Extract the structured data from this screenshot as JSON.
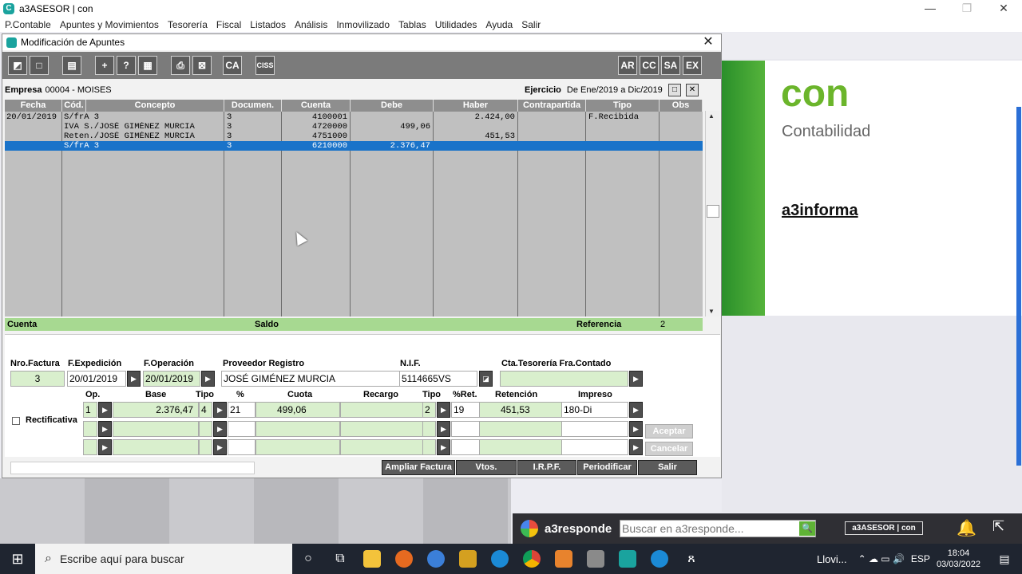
{
  "app": {
    "title": "a3ASESOR | con"
  },
  "menu": [
    "P.Contable",
    "Apuntes y Movimientos",
    "Tesorería",
    "Fiscal",
    "Listados",
    "Análisis",
    "Inmovilizado",
    "Tablas",
    "Utilidades",
    "Ayuda",
    "Salir"
  ],
  "dialog": {
    "title": "Modificación de Apuntes",
    "toolbar_right": [
      "AR",
      "CC",
      "SA",
      "EX"
    ],
    "toolbar_ca": "CA",
    "toolbar_ciss": "CISS",
    "empresa_label": "Empresa",
    "empresa_value": "00004 - MOISES",
    "ejercicio_label": "Ejercicio",
    "ejercicio_value": "De Ene/2019 a Dic/2019",
    "grid": {
      "headers": [
        "Fecha",
        "Cód.",
        "Concepto",
        "Documen.",
        "Cuenta",
        "Debe",
        "Haber",
        "Contrapartida",
        "Tipo",
        "Obs"
      ],
      "rows": [
        {
          "fecha": "20/01/2019",
          "concepto": "S/frA 3",
          "documento": "3",
          "cuenta": "4100001",
          "debe": "",
          "haber": "2.424,00",
          "contrapartida": "",
          "tipo": "F.Recibida",
          "obs": ""
        },
        {
          "fecha": "",
          "concepto": "IVA S./JOSÉ GIMÉNEZ MURCIA",
          "documento": "3",
          "cuenta": "4720000",
          "debe": "499,06",
          "haber": "",
          "contrapartida": "",
          "tipo": "",
          "obs": ""
        },
        {
          "fecha": "",
          "concepto": "Reten./JOSÉ GIMÉNEZ MURCIA",
          "documento": "3",
          "cuenta": "4751000",
          "debe": "",
          "haber": "451,53",
          "contrapartida": "",
          "tipo": "",
          "obs": ""
        },
        {
          "fecha": "",
          "concepto": "S/frA 3",
          "documento": "3",
          "cuenta": "6210000",
          "debe": "2.376,47",
          "haber": "",
          "contrapartida": "",
          "tipo": "",
          "obs": ""
        }
      ]
    },
    "status": {
      "cuenta": "Cuenta",
      "saldo": "Saldo",
      "referencia_label": "Referencia",
      "referencia_value": "2"
    },
    "invoice": {
      "labels": {
        "nro_factura": "Nro.Factura",
        "f_expedicion": "F.Expedición",
        "f_operacion": "F.Operación",
        "proveedor": "Proveedor Registro",
        "nif": "N.I.F.",
        "cta_tesoreria": "Cta.Tesorería Fra.Contado",
        "op": "Op.",
        "base": "Base",
        "tipo": "Tipo",
        "pct": "%",
        "cuota": "Cuota",
        "recargo": "Recargo",
        "tipo2": "Tipo",
        "pct_ret": "%Ret.",
        "retencion": "Retención",
        "impreso": "Impreso",
        "rectificativa": "Rectificativa"
      },
      "nro_factura": "3",
      "f_expedicion": "20/01/2019",
      "f_operacion": "20/01/2019",
      "proveedor": "JOSÉ GIMÉNEZ MURCIA",
      "nif": "5114665VS",
      "cta_tesoreria": "",
      "line1": {
        "op": "1",
        "base": "2.376,47",
        "tipo": "4",
        "pct": "21",
        "cuota": "499,06",
        "recargo": "",
        "tipo2": "2",
        "pct_ret": "19",
        "retencion": "451,53",
        "impreso": "180-Di"
      },
      "aceptar": "Aceptar",
      "cancelar": "Cancelar"
    },
    "bottom_buttons": [
      "Ampliar Factura",
      "Vtos.",
      "I.R.P.F.",
      "Periodificar",
      "Salir"
    ]
  },
  "brand": {
    "con": "con",
    "contabilidad": "Contabilidad",
    "informa": "a3informa"
  },
  "a3responde": {
    "label": "a3responde",
    "search_placeholder": "Buscar en a3responde...",
    "badge": "a3ASESOR | con"
  },
  "taskbar": {
    "search_placeholder": "Escribe aquí para buscar",
    "weather": "Llovi...",
    "lang": "ESP",
    "time": "18:04",
    "date": "03/03/2022"
  },
  "colors": {
    "green_field": "#d9efcd",
    "selection": "#1a73c9",
    "brand_green": "#6bb52b"
  }
}
